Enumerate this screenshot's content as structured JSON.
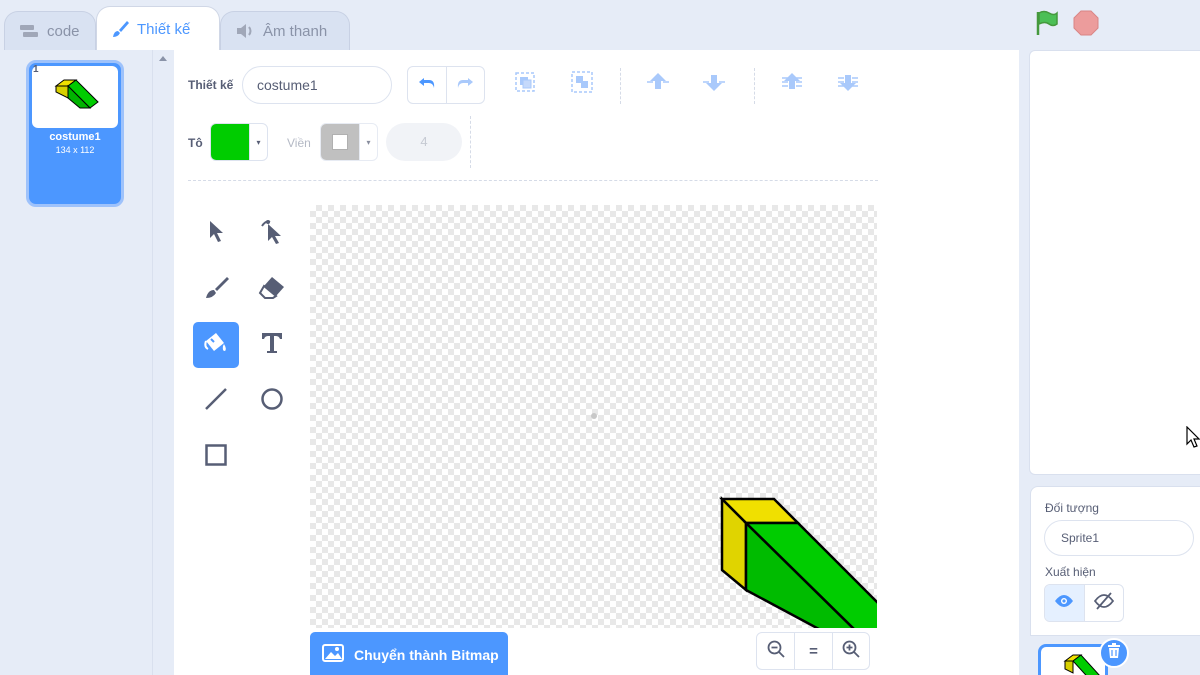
{
  "tabs": [
    {
      "label": "code",
      "icon": "code-blocks-icon"
    },
    {
      "label": "Thiết kế",
      "icon": "paintbrush-icon"
    },
    {
      "label": "Âm thanh",
      "icon": "speaker-icon"
    }
  ],
  "costumes": [
    {
      "index": "1",
      "name": "costume1",
      "size": "134 x 112"
    }
  ],
  "editor": {
    "design_label": "Thiết kế",
    "costume_name": "costume1",
    "fill_label": "Tô",
    "outline_label": "Viền",
    "outline_width": "4",
    "fill_color": "#00cc00",
    "outline_color": "#a6a6a6",
    "convert_button": "Chuyển thành Bitmap",
    "zoom_reset_label": "="
  },
  "sprite_panel": {
    "sprite_label": "Đối tượng",
    "sprite_name": "Sprite1",
    "show_label": "Xuất hiện"
  },
  "colors": {
    "accent": "#4c97ff",
    "green": "#00cc00",
    "yellow": "#f0e000"
  }
}
